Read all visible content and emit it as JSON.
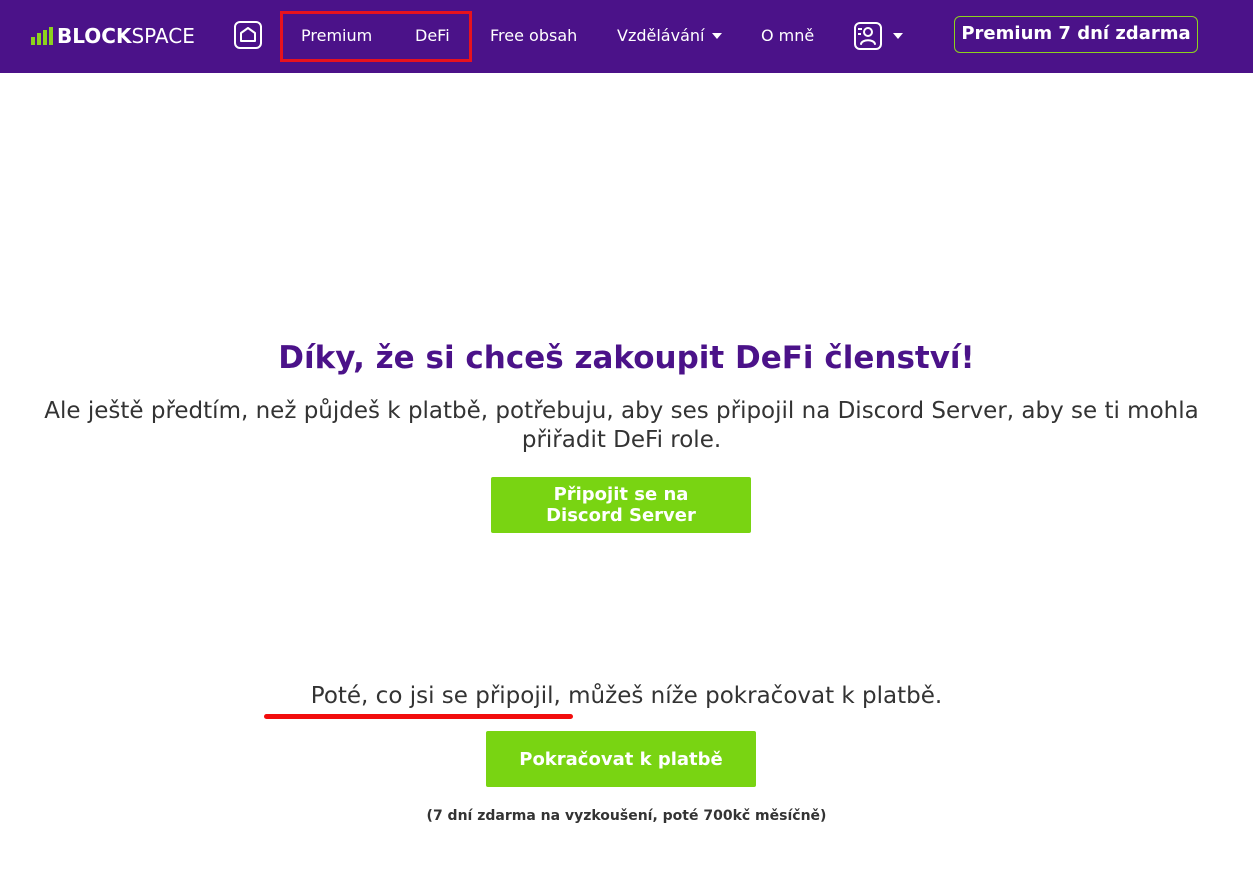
{
  "colors": {
    "navbar_bg": "#4b1289",
    "accent_green": "#79d412",
    "logo_green": "#8dd21e",
    "headline": "#4b1289",
    "annotation_red": "#e8121e"
  },
  "navbar": {
    "logo_bold": "BLOCK",
    "logo_light": "SPACE",
    "home_icon": "home-icon",
    "links": {
      "premium": "Premium",
      "defi": "DeFi",
      "free": "Free obsah",
      "education": "Vzdělávání",
      "about": "O mně"
    },
    "account_icon": "account-icon",
    "cta": "Premium 7 dní zdarma"
  },
  "main": {
    "headline": "Díky, že si chceš zakoupit DeFi členství!",
    "subtext": "Ale ještě předtím, než půjdeš k platbě, potřebuju, aby ses připojil na Discord Server, aby se ti mohla přiřadit DeFi role.",
    "discord_button": "Připojit se na Discord Server",
    "after_text": "Poté, co jsi se připojil, můžeš níže pokračovat k platbě.",
    "pay_button": "Pokračovat k platbě",
    "footnote": "(7 dní zdarma na vyzkoušení, poté 700kč měsíčně)"
  }
}
